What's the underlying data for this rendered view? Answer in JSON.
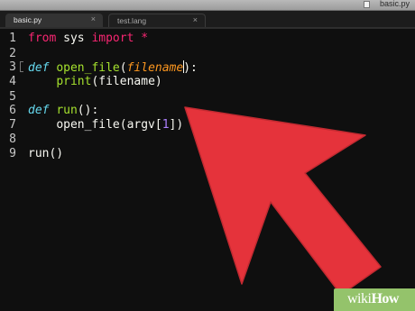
{
  "window": {
    "title": "basic.py"
  },
  "tabs": [
    {
      "label": "basic.py",
      "active": true,
      "close": "×"
    },
    {
      "label": "test.lang",
      "active": false,
      "close": "×"
    }
  ],
  "editor": {
    "line_numbers": [
      "1",
      "2",
      "3",
      "4",
      "5",
      "6",
      "7",
      "8",
      "9"
    ],
    "lines": {
      "l1": {
        "kw_from": "from",
        "mod": " sys ",
        "kw_import": "import",
        "star": " *"
      },
      "l3": {
        "kw_def": "def",
        "sp": " ",
        "fn": "open_file",
        "paren_open": "(",
        "param": "filename",
        "paren_close": ")",
        "colon": ":"
      },
      "l4": {
        "indent": "    ",
        "fn": "print",
        "rest": "(filename)"
      },
      "l6": {
        "kw_def": "def",
        "sp": " ",
        "fn": "run",
        "rest": "():"
      },
      "l7": {
        "indent": "    ",
        "text_a": "open_file(argv[",
        "num": "1",
        "text_b": "])"
      },
      "l9": {
        "text": "run()"
      }
    },
    "colors": {
      "background": "#0f0f0f",
      "keyword": "#f92672",
      "function": "#a6e22e",
      "def_keyword": "#66d9ef",
      "parameter": "#fd971f",
      "number": "#ae81ff",
      "text": "#f8f8f2"
    }
  },
  "overlay": {
    "arrow_color": "#e5333b",
    "arrow_points_at": "cursor after filename on line 3"
  },
  "watermark": {
    "part1": "wiki",
    "part2": "How",
    "color": "#94c36b"
  }
}
